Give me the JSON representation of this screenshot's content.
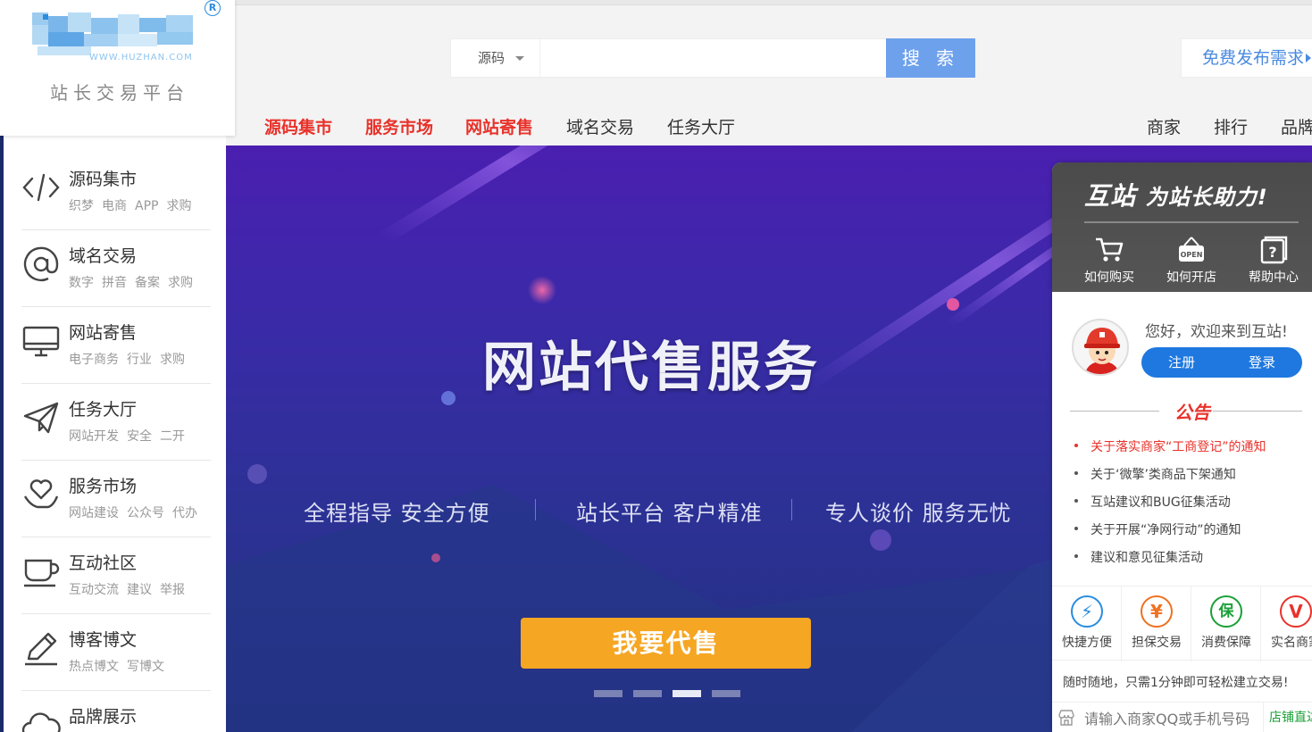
{
  "logo": {
    "url_text": "WWW.HUZHAN.COM",
    "registered_mark": "R",
    "slogan": "站长交易平台"
  },
  "search": {
    "category": "源码",
    "placeholder": "",
    "button_label": "搜 索"
  },
  "header": {
    "publish_label": "免费发布需求"
  },
  "main_nav": {
    "items": [
      {
        "label": "源码集市",
        "hot": true
      },
      {
        "label": "服务市场",
        "hot": true
      },
      {
        "label": "网站寄售",
        "hot": true
      },
      {
        "label": "域名交易",
        "hot": false
      },
      {
        "label": "任务大厅",
        "hot": false
      }
    ],
    "right_items": [
      "商家",
      "排行",
      "品牌"
    ]
  },
  "sidebar": {
    "categories": [
      {
        "icon": "code-icon",
        "title": "源码集市",
        "subs": [
          "织梦",
          "电商",
          "APP",
          "求购"
        ]
      },
      {
        "icon": "at-icon",
        "title": "域名交易",
        "subs": [
          "数字",
          "拼音",
          "备案",
          "求购"
        ]
      },
      {
        "icon": "monitor-icon",
        "title": "网站寄售",
        "subs": [
          "电子商务",
          "行业",
          "求购"
        ]
      },
      {
        "icon": "paper-plane-icon",
        "title": "任务大厅",
        "subs": [
          "网站开发",
          "安全",
          "二开"
        ]
      },
      {
        "icon": "heart-hand-icon",
        "title": "服务市场",
        "subs": [
          "网站建设",
          "公众号",
          "代办"
        ]
      },
      {
        "icon": "cup-icon",
        "title": "互动社区",
        "subs": [
          "互动交流",
          "建议",
          "举报"
        ]
      },
      {
        "icon": "pencil-icon",
        "title": "博客博文",
        "subs": [
          "热点博文",
          "写博文"
        ]
      },
      {
        "icon": "cloud-icon",
        "title": "品牌展示",
        "subs": []
      }
    ]
  },
  "banner": {
    "title": "网站代售服务",
    "features": [
      "全程指导 安全方便",
      "站长平台 客户精准",
      "专人谈价 服务无忧"
    ],
    "cta_label": "我要代售",
    "slide_count": 4,
    "active_slide": 3
  },
  "right_panel": {
    "slogan_main": "互站",
    "slogan_rest": "为站长助力!",
    "tools": [
      {
        "icon": "cart-icon",
        "label": "如何购买"
      },
      {
        "icon": "open-sign-icon",
        "label": "如何开店"
      },
      {
        "icon": "help-icon",
        "label": "帮助中心"
      }
    ],
    "greeting": "您好，欢迎来到互站!",
    "register_label": "注册",
    "login_label": "登录",
    "notice_title": "公告",
    "notices": [
      {
        "text": "关于落实商家“工商登记”的通知",
        "highlight": true
      },
      {
        "text": "关于‘微擎’类商品下架通知",
        "highlight": false
      },
      {
        "text": "互站建议和BUG征集活动",
        "highlight": false
      },
      {
        "text": "关于开展“净网行动”的通知",
        "highlight": false
      },
      {
        "text": "建议和意见征集活动",
        "highlight": false
      }
    ],
    "features": [
      {
        "icon": "bolt-icon",
        "symbol": "⚡",
        "label": "快捷方便",
        "color": "#2a8cdf"
      },
      {
        "icon": "yen-icon",
        "symbol": "¥",
        "label": "担保交易",
        "color": "#f07020"
      },
      {
        "icon": "shield-icon",
        "symbol": "保",
        "label": "消费保障",
        "color": "#1aa037"
      },
      {
        "icon": "verified-icon",
        "symbol": "V",
        "label": "实名商家",
        "color": "#e8322b"
      }
    ],
    "tip": "随时随地，只需1分钟即可轻松建立交易!",
    "store_search_placeholder": "请输入商家QQ或手机号码",
    "store_go_label": "店铺直达"
  }
}
